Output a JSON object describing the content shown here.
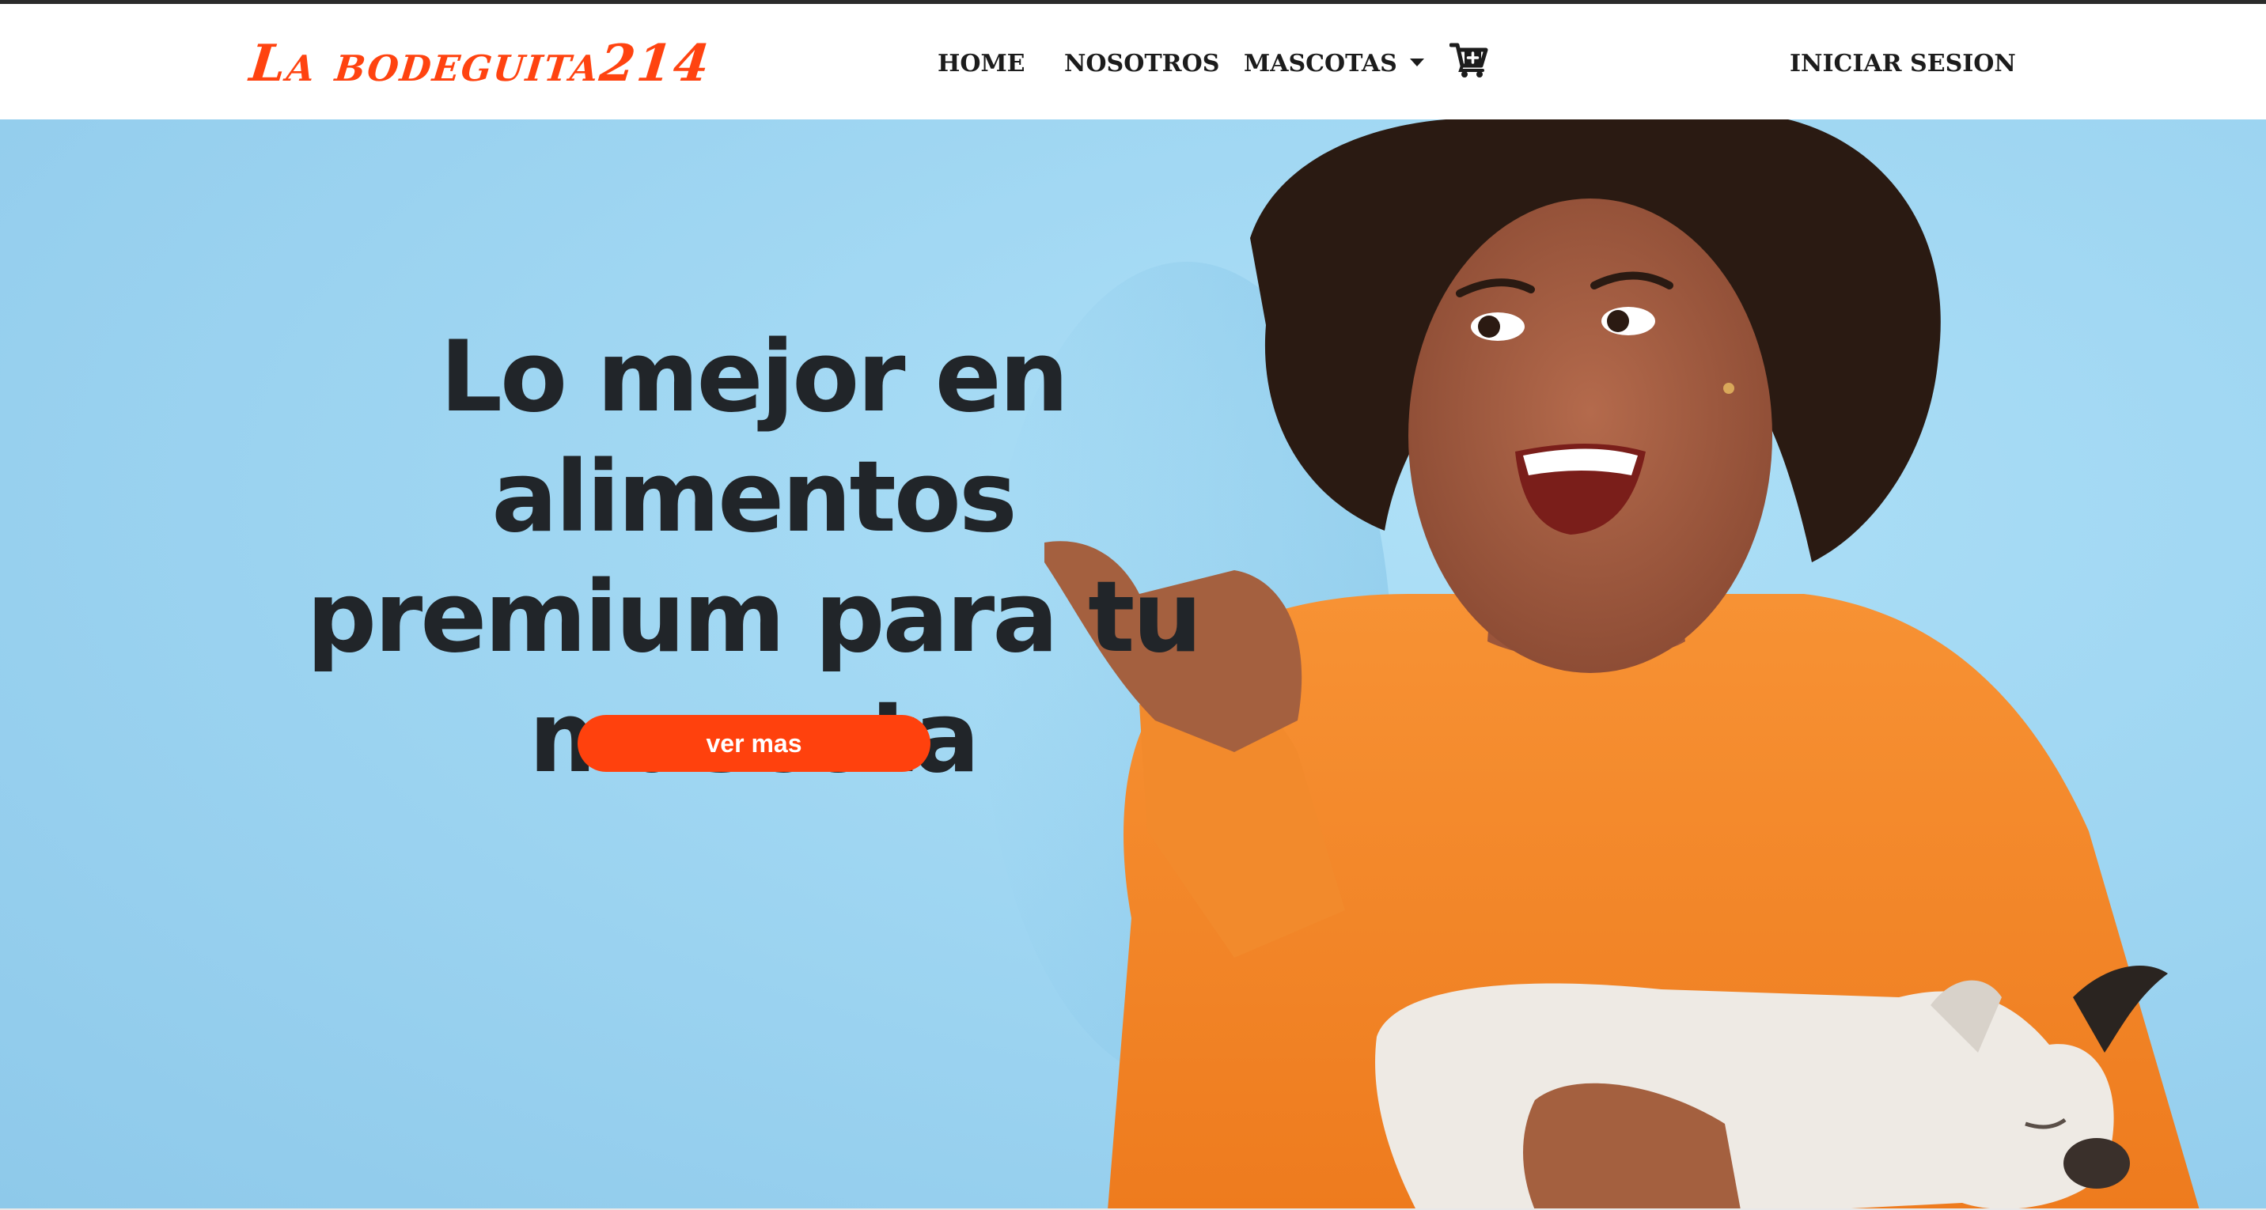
{
  "navbar": {
    "brand": "La bodeguita214",
    "links": {
      "home": "HOME",
      "nosotros": "NOSOTROS",
      "mascotas": "MASCOTAS"
    },
    "cart_icon": "cart-plus-icon",
    "login": "INICIAR SESION"
  },
  "hero": {
    "title": "Lo mejor en alimentos premium para tu mascota",
    "button": "ver mas",
    "image": "woman-in-orange-sweater-holding-puppy-photo"
  },
  "colors": {
    "brand": "#ff4310",
    "button": "#ff410d",
    "hero_background": "#9fd6f2",
    "text_dark": "#212529",
    "sweater": "#f58a2a"
  }
}
